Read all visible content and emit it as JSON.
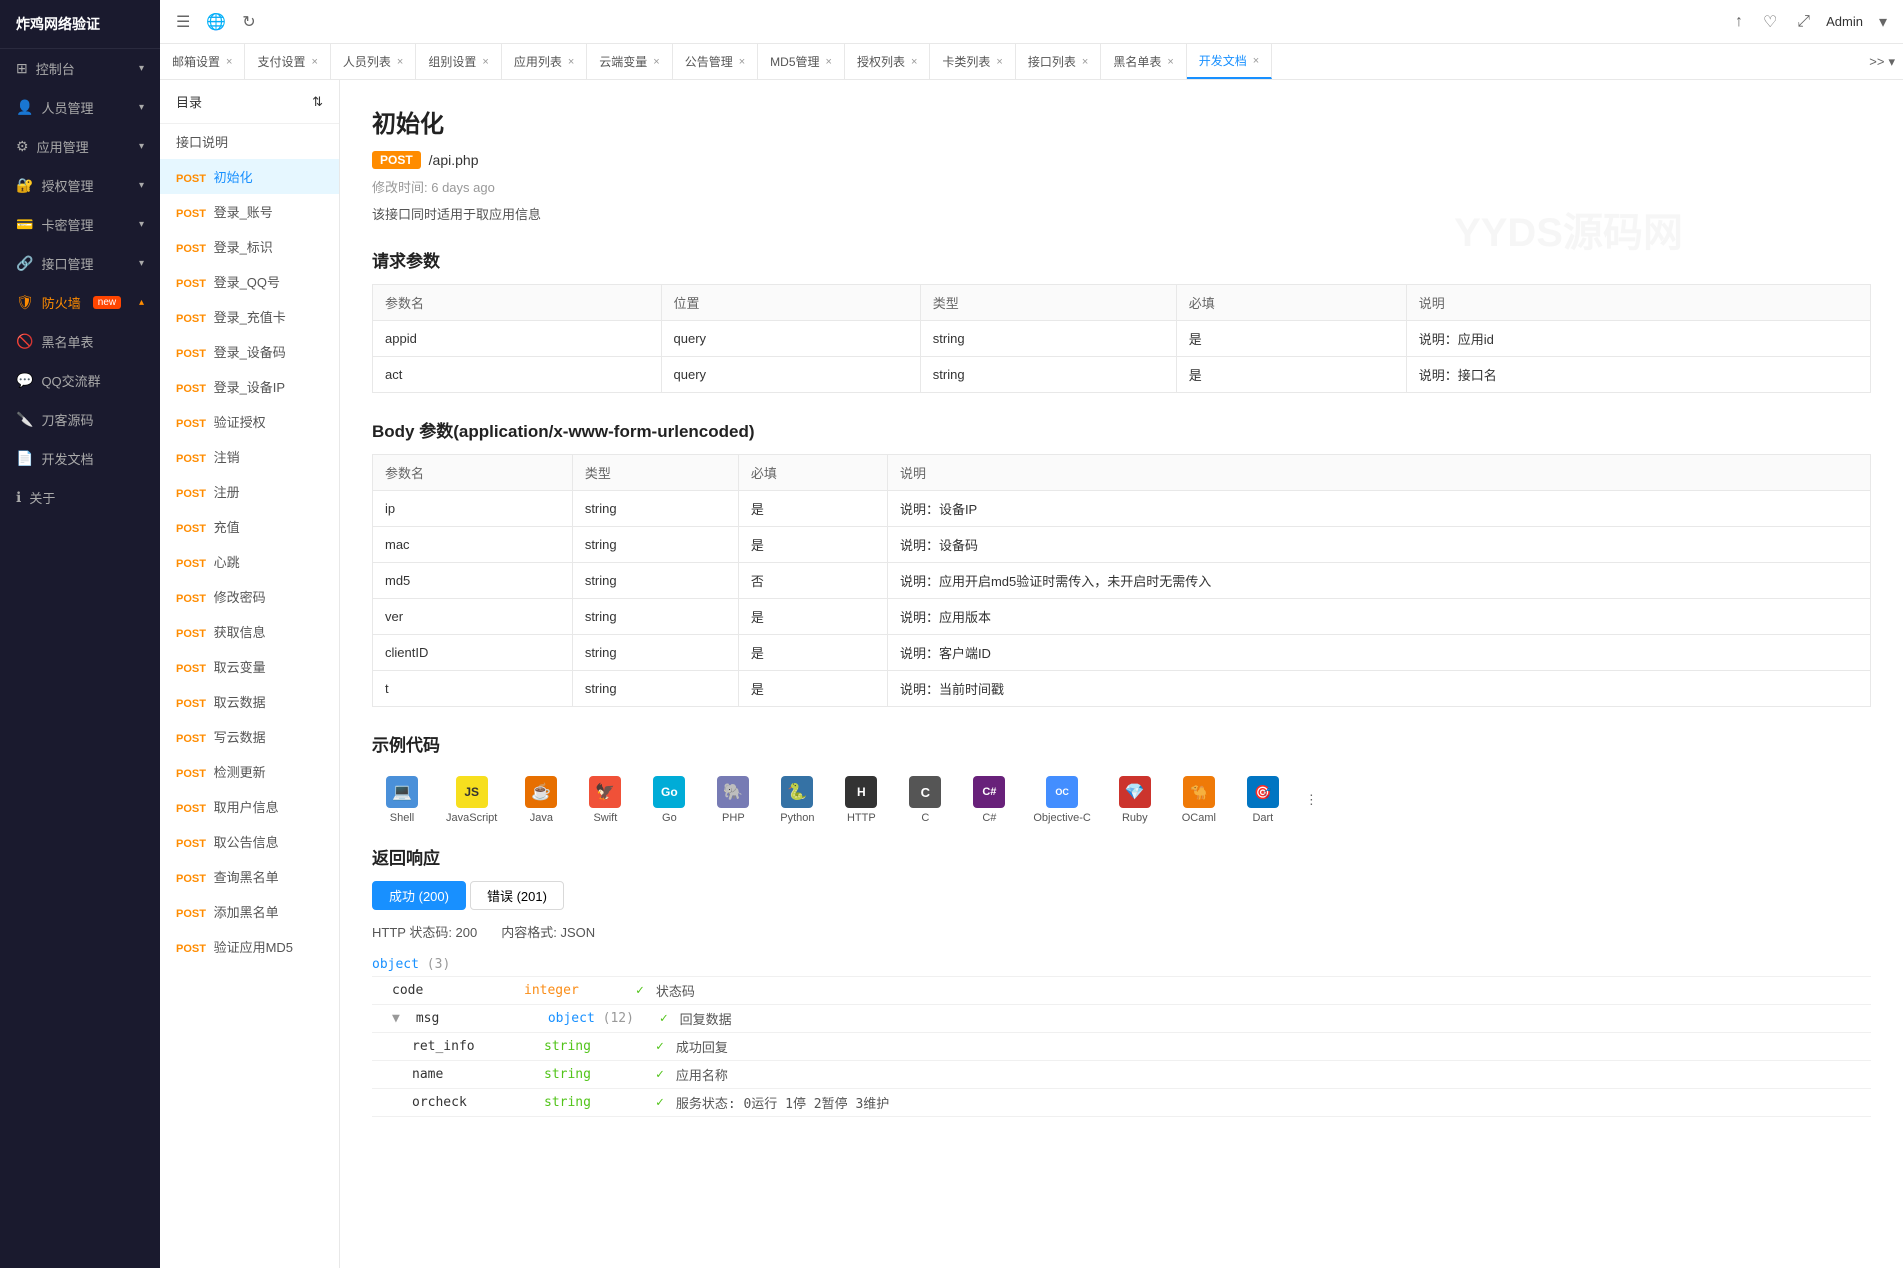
{
  "sidebar": {
    "logo": "炸鸡网络验证",
    "items": [
      {
        "id": "dashboard",
        "label": "控制台",
        "icon": "⊞",
        "hasArrow": true
      },
      {
        "id": "user-mgmt",
        "label": "人员管理",
        "icon": "👤",
        "hasArrow": true
      },
      {
        "id": "app-mgmt",
        "label": "应用管理",
        "icon": "⚙",
        "hasArrow": true
      },
      {
        "id": "auth-mgmt",
        "label": "授权管理",
        "icon": "🔐",
        "hasArrow": true
      },
      {
        "id": "card-mgmt",
        "label": "卡密管理",
        "icon": "💳",
        "hasArrow": true
      },
      {
        "id": "api-mgmt",
        "label": "接口管理",
        "icon": "🔗",
        "hasArrow": true
      },
      {
        "id": "firewall",
        "label": "防火墙",
        "icon": "🛡",
        "hasArrow": true,
        "badge": "new",
        "active": true
      },
      {
        "id": "blacklist",
        "label": "黑名单表",
        "icon": "🚫",
        "hasArrow": false
      },
      {
        "id": "qq-group",
        "label": "QQ交流群",
        "icon": "💬",
        "hasArrow": false
      },
      {
        "id": "source-code",
        "label": "刀客源码",
        "icon": "🔪",
        "hasArrow": false
      },
      {
        "id": "dev-docs",
        "label": "开发文档",
        "icon": "📄",
        "hasArrow": false
      },
      {
        "id": "about",
        "label": "关于",
        "icon": "ℹ",
        "hasArrow": false
      }
    ]
  },
  "topbar": {
    "icons": [
      "☰",
      "🌐",
      "↻"
    ],
    "right": {
      "upload_icon": "↑",
      "bell_icon": "♡",
      "expand_icon": "⤢",
      "admin_label": "Admin",
      "dropdown_icon": "▾"
    }
  },
  "tabs": [
    {
      "id": "email",
      "label": "邮箱设置",
      "closable": true
    },
    {
      "id": "payment",
      "label": "支付设置",
      "closable": true
    },
    {
      "id": "staff",
      "label": "人员列表",
      "closable": true
    },
    {
      "id": "group",
      "label": "组别设置",
      "closable": true
    },
    {
      "id": "applist",
      "label": "应用列表",
      "closable": true
    },
    {
      "id": "cloudvar",
      "label": "云端变量",
      "closable": true
    },
    {
      "id": "announce",
      "label": "公告管理",
      "closable": true
    },
    {
      "id": "md5",
      "label": "MD5管理",
      "closable": true
    },
    {
      "id": "auth",
      "label": "授权列表",
      "closable": true
    },
    {
      "id": "cardtype",
      "label": "卡类列表",
      "closable": true
    },
    {
      "id": "apilist",
      "label": "接口列表",
      "closable": true
    },
    {
      "id": "blacklist2",
      "label": "黑名单表",
      "closable": true
    },
    {
      "id": "devdocs",
      "label": "开发文档",
      "closable": true,
      "active": true
    }
  ],
  "doc_sidebar": {
    "header": "目录",
    "items": [
      {
        "id": "api-desc",
        "label": "接口说明",
        "method": null
      },
      {
        "id": "init",
        "label": "初始化",
        "method": "POST",
        "active": true
      },
      {
        "id": "login-account",
        "label": "登录_账号",
        "method": "POST"
      },
      {
        "id": "login-mark",
        "label": "登录_标识",
        "method": "POST"
      },
      {
        "id": "login-qq",
        "label": "登录_QQ号",
        "method": "POST"
      },
      {
        "id": "login-card",
        "label": "登录_充值卡",
        "method": "POST"
      },
      {
        "id": "login-device",
        "label": "登录_设备码",
        "method": "POST"
      },
      {
        "id": "login-deviceip",
        "label": "登录_设备IP",
        "method": "POST"
      },
      {
        "id": "verify-auth",
        "label": "验证授权",
        "method": "POST"
      },
      {
        "id": "logout",
        "label": "注销",
        "method": "POST"
      },
      {
        "id": "register",
        "label": "注册",
        "method": "POST"
      },
      {
        "id": "recharge",
        "label": "充值",
        "method": "POST"
      },
      {
        "id": "heartbeat",
        "label": "心跳",
        "method": "POST"
      },
      {
        "id": "change-pwd",
        "label": "修改密码",
        "method": "POST"
      },
      {
        "id": "get-info",
        "label": "获取信息",
        "method": "POST"
      },
      {
        "id": "get-cloud",
        "label": "取云变量",
        "method": "POST"
      },
      {
        "id": "get-cloud-data",
        "label": "取云数据",
        "method": "POST"
      },
      {
        "id": "write-cloud",
        "label": "写云数据",
        "method": "POST"
      },
      {
        "id": "check-update",
        "label": "检测更新",
        "method": "POST"
      },
      {
        "id": "get-user-info",
        "label": "取用户信息",
        "method": "POST"
      },
      {
        "id": "get-announce",
        "label": "取公告信息",
        "method": "POST"
      },
      {
        "id": "query-blacklist",
        "label": "查询黑名单",
        "method": "POST"
      },
      {
        "id": "add-blacklist",
        "label": "添加黑名单",
        "method": "POST"
      },
      {
        "id": "verify-md5",
        "label": "验证应用MD5",
        "method": "POST"
      }
    ]
  },
  "page": {
    "title": "初始化",
    "method": "POST",
    "endpoint": "/api.php",
    "modified": "修改时间: 6 days ago",
    "description": "该接口同时适用于取应用信息",
    "request_params_title": "请求参数",
    "request_params": {
      "columns": [
        "参数名",
        "位置",
        "类型",
        "必填",
        "说明"
      ],
      "rows": [
        {
          "name": "appid",
          "location": "query",
          "type": "string",
          "required": "是",
          "desc": "说明：应用id"
        },
        {
          "name": "act",
          "location": "query",
          "type": "string",
          "required": "是",
          "desc": "说明：接口名"
        }
      ]
    },
    "body_params_title": "Body 参数(application/x-www-form-urlencoded)",
    "body_params": {
      "columns": [
        "参数名",
        "类型",
        "必填",
        "说明"
      ],
      "rows": [
        {
          "name": "ip",
          "type": "string",
          "required": "是",
          "desc": "说明：设备IP"
        },
        {
          "name": "mac",
          "type": "string",
          "required": "是",
          "desc": "说明：设备码"
        },
        {
          "name": "md5",
          "type": "string",
          "required": "否",
          "desc": "说明：应用开启md5验证时需传入，未开启时无需传入"
        },
        {
          "name": "ver",
          "type": "string",
          "required": "是",
          "desc": "说明：应用版本"
        },
        {
          "name": "clientID",
          "type": "string",
          "required": "是",
          "desc": "说明：客户端ID"
        },
        {
          "name": "t",
          "type": "string",
          "required": "是",
          "desc": "说明：当前时间戳"
        }
      ]
    },
    "example_code_title": "示例代码",
    "code_langs": [
      {
        "id": "shell",
        "label": "Shell",
        "icon": "🐚",
        "color": "#4a90d9"
      },
      {
        "id": "javascript",
        "label": "JavaScript",
        "icon": "JS",
        "color": "#f7df1e"
      },
      {
        "id": "java",
        "label": "Java",
        "icon": "☕",
        "color": "#e76f00"
      },
      {
        "id": "swift",
        "label": "Swift",
        "icon": "🦅",
        "color": "#f05138"
      },
      {
        "id": "go",
        "label": "Go",
        "icon": "Go",
        "color": "#00acd7"
      },
      {
        "id": "php",
        "label": "PHP",
        "icon": "🐘",
        "color": "#777bb4"
      },
      {
        "id": "python",
        "label": "Python",
        "icon": "🐍",
        "color": "#3572a5"
      },
      {
        "id": "http",
        "label": "HTTP",
        "icon": "H",
        "color": "#333"
      },
      {
        "id": "c",
        "label": "C",
        "icon": "C",
        "color": "#555"
      },
      {
        "id": "csharp",
        "label": "C#",
        "icon": "C#",
        "color": "#68217a"
      },
      {
        "id": "objc",
        "label": "Objective-C",
        "icon": "OC",
        "color": "#438eff"
      },
      {
        "id": "ruby",
        "label": "Ruby",
        "icon": "💎",
        "color": "#cc342d"
      },
      {
        "id": "ocaml",
        "label": "OCaml",
        "icon": "🐪",
        "color": "#ef7a08"
      },
      {
        "id": "dart",
        "label": "Dart",
        "icon": "🎯",
        "color": "#0175c2"
      }
    ],
    "response_title": "返回响应",
    "response_tabs": [
      {
        "id": "success",
        "label": "成功 (200)",
        "active": true
      },
      {
        "id": "error",
        "label": "错误 (201)",
        "active": false
      }
    ],
    "http_status": "HTTP 状态码: 200",
    "content_format": "内容格式: JSON",
    "response_object": {
      "type": "object",
      "count": 3,
      "fields": [
        {
          "name": "code",
          "type": "integer",
          "status": "✓",
          "desc": "状态码",
          "indent": 1
        },
        {
          "name": "msg",
          "type": "object (12)",
          "status": "✓",
          "desc": "回复数据",
          "indent": 1,
          "collapsible": true
        },
        {
          "name": "ret_info",
          "type": "string",
          "status": "✓",
          "desc": "成功回复",
          "indent": 2
        },
        {
          "name": "name",
          "type": "string",
          "status": "✓",
          "desc": "应用名称",
          "indent": 2
        },
        {
          "name": "orcheck",
          "type": "string",
          "status": "✓",
          "desc": "服务状态: 0 运行 1 停 2 暂停 3 维护",
          "indent": 2
        }
      ]
    }
  }
}
